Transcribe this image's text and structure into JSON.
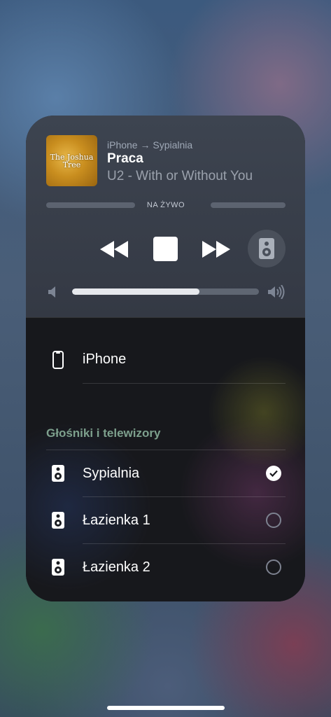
{
  "now_playing": {
    "album_art_text": "The Joshua Tree",
    "route": "iPhone → Sypialnia",
    "title": "Praca",
    "subtitle": "U2 - With or Without You",
    "live_label": "NA ŻYWO",
    "volume": 0.68
  },
  "controls": {
    "rewind": "rewind-icon",
    "stop": "stop-icon",
    "forward": "fast-forward-icon",
    "speaker": "speaker-icon"
  },
  "devices": {
    "iphone_label": "iPhone",
    "section_title": "Głośniki i telewizory",
    "speakers": [
      {
        "label": "Sypialnia",
        "selected": true
      },
      {
        "label": "Łazienka 1",
        "selected": false
      },
      {
        "label": "Łazienka 2",
        "selected": false
      }
    ]
  },
  "colors": {
    "section_title": "#7da08d",
    "check_fill": "#ffffff"
  }
}
